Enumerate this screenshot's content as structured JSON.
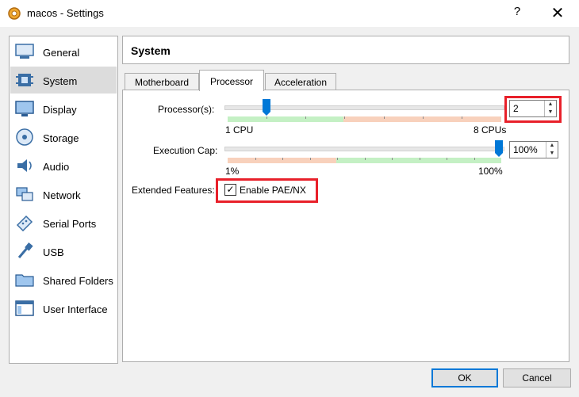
{
  "window": {
    "title": "macos - Settings",
    "help_label": "?",
    "close_label": "✕"
  },
  "sidebar": {
    "items": [
      {
        "label": "General",
        "icon": "general-icon"
      },
      {
        "label": "System",
        "icon": "system-chip-icon",
        "selected": true
      },
      {
        "label": "Display",
        "icon": "display-icon"
      },
      {
        "label": "Storage",
        "icon": "storage-icon"
      },
      {
        "label": "Audio",
        "icon": "audio-icon"
      },
      {
        "label": "Network",
        "icon": "network-icon"
      },
      {
        "label": "Serial Ports",
        "icon": "serial-ports-icon"
      },
      {
        "label": "USB",
        "icon": "usb-icon"
      },
      {
        "label": "Shared Folders",
        "icon": "shared-folders-icon"
      },
      {
        "label": "User Interface",
        "icon": "user-interface-icon"
      }
    ]
  },
  "header": {
    "title": "System"
  },
  "tabs": [
    {
      "label": "Motherboard"
    },
    {
      "label": "Processor",
      "active": true
    },
    {
      "label": "Acceleration"
    }
  ],
  "processor": {
    "label": "Processor(s):",
    "value": "2",
    "min_label": "1 CPU",
    "max_label": "8 CPUs",
    "level": 2,
    "min": 1,
    "max": 8
  },
  "execution_cap": {
    "label": "Execution Cap:",
    "value": "100%",
    "min_label": "1%",
    "max_label": "100%",
    "level": 100
  },
  "extended_features": {
    "label": "Extended Features:",
    "checkbox_label": "Enable PAE/NX",
    "checked": true
  },
  "footer": {
    "ok_label": "OK",
    "cancel_label": "Cancel"
  },
  "colors": {
    "accent": "#0078d7",
    "highlight_box": "#e8202a",
    "scale_green": "#c4f0c4",
    "scale_orange": "#f8d1bc"
  }
}
